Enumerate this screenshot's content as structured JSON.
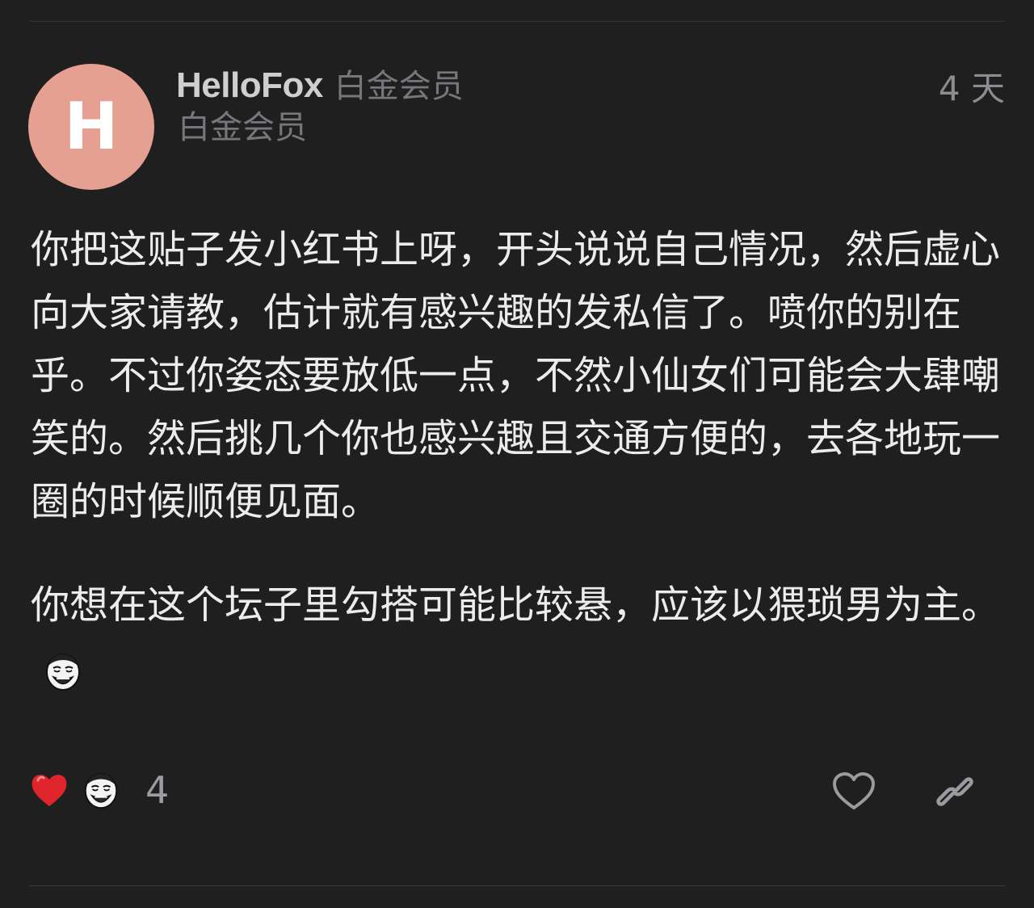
{
  "post": {
    "avatar_letter": "H",
    "avatar_color": "#e6a091",
    "username": "HelloFox",
    "badge_inline": "白金会员",
    "badge_second": "白金会员",
    "timestamp": "4 天",
    "paragraphs": [
      "你把这贴子发小红书上呀，开头说说自己情况，然后虚心向大家请教，估计就有感兴趣的发私信了。喷你的别在乎。不过你姿态要放低一点，不然小仙女们可能会大肆嘲笑的。然后挑几个你也感兴趣且交通方便的，去各地玩一圈的时候顺便见面。",
      "你想在这个坛子里勾搭可能比较悬，应该以猥琐男为主。"
    ],
    "inline_emoji": "laughing-meme-face-icon"
  },
  "reactions": {
    "items": [
      "red-heart-icon",
      "laughing-meme-face-icon"
    ],
    "count": "4"
  },
  "actions": {
    "like_icon": "heart-outline-icon",
    "link_icon": "link-icon"
  },
  "colors": {
    "background": "#1f1f20",
    "text": "#ececed",
    "muted": "#77777b",
    "avatar": "#e6a091",
    "heart": "#e0242c"
  }
}
